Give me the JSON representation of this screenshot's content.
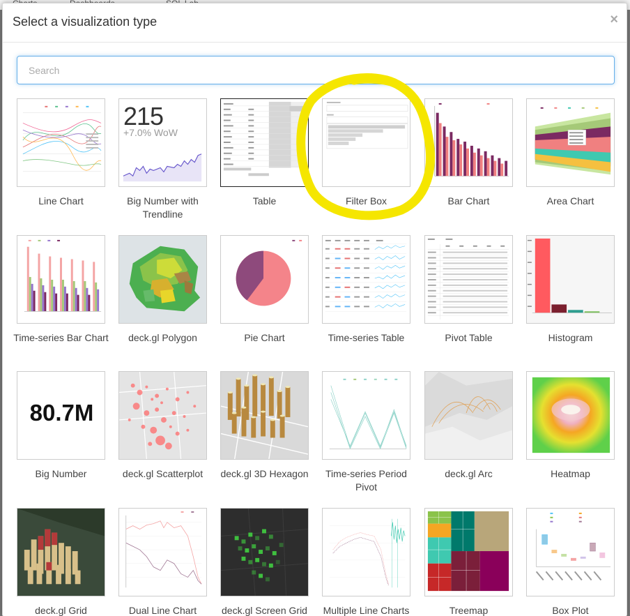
{
  "dialog": {
    "title": "Select a visualization type",
    "close_symbol": "×",
    "search_placeholder": "Search"
  },
  "background": {
    "items": [
      "Charts",
      "Dashboards",
      "SQL Lab"
    ]
  },
  "charts": [
    {
      "name": "Line Chart",
      "thumbnail": "line-chart"
    },
    {
      "name": "Big Number with Trendline",
      "thumbnail": "big-number-trendline",
      "value": "215",
      "delta": "+7.0% WoW"
    },
    {
      "name": "Table",
      "thumbnail": "table",
      "selected": true
    },
    {
      "name": "Filter Box",
      "thumbnail": "filter-box",
      "highlighted": true
    },
    {
      "name": "Bar Chart",
      "thumbnail": "bar-chart"
    },
    {
      "name": "Area Chart",
      "thumbnail": "area-chart"
    },
    {
      "name": "Time-series Bar Chart",
      "thumbnail": "timeseries-bar"
    },
    {
      "name": "deck.gl Polygon",
      "thumbnail": "deckgl-polygon"
    },
    {
      "name": "Pie Chart",
      "thumbnail": "pie-chart"
    },
    {
      "name": "Time-series Table",
      "thumbnail": "timeseries-table"
    },
    {
      "name": "Pivot Table",
      "thumbnail": "pivot-table"
    },
    {
      "name": "Histogram",
      "thumbnail": "histogram"
    },
    {
      "name": "Big Number",
      "thumbnail": "big-number",
      "value": "80.7M"
    },
    {
      "name": "deck.gl Scatterplot",
      "thumbnail": "deckgl-scatterplot"
    },
    {
      "name": "deck.gl 3D Hexagon",
      "thumbnail": "deckgl-hexagon"
    },
    {
      "name": "Time-series Period Pivot",
      "thumbnail": "timeseries-period-pivot"
    },
    {
      "name": "deck.gl Arc",
      "thumbnail": "deckgl-arc"
    },
    {
      "name": "Heatmap",
      "thumbnail": "heatmap"
    },
    {
      "name": "deck.gl Grid",
      "thumbnail": "deckgl-grid"
    },
    {
      "name": "Dual Line Chart",
      "thumbnail": "dual-line-chart"
    },
    {
      "name": "deck.gl Screen Grid",
      "thumbnail": "deckgl-screen-grid"
    },
    {
      "name": "Multiple Line Charts",
      "thumbnail": "multiple-line-charts"
    },
    {
      "name": "Treemap",
      "thumbnail": "treemap"
    },
    {
      "name": "Box Plot",
      "thumbnail": "box-plot"
    }
  ],
  "annotation": {
    "shape": "circle",
    "color": "#f5e600",
    "around": "Filter Box"
  }
}
